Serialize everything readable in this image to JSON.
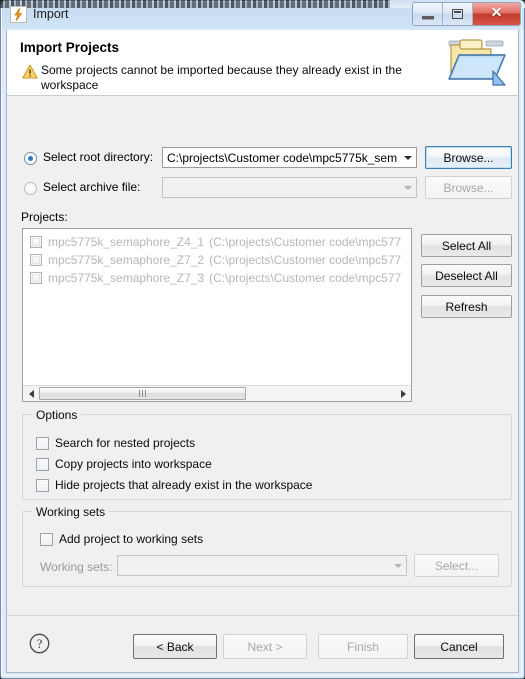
{
  "window": {
    "title": "Import",
    "app_icon": "import-wizard-icon",
    "controls": {
      "minimize": "minimize-button",
      "maximize": "restore-button",
      "close": "close-button"
    }
  },
  "header": {
    "title": "Import Projects",
    "message": "Some projects cannot be imported because they already exist in the workspace",
    "warning_icon": "warning-triangle-icon",
    "banner_icon": "open-folder-icon",
    "warning_color": "#f0b429"
  },
  "source": {
    "root_directory": {
      "label": "Select root directory:",
      "selected": true,
      "value": "C:\\projects\\Customer code\\mpc5775k_sem",
      "browse_label": "Browse...",
      "browse_enabled": true
    },
    "archive_file": {
      "label": "Select archive file:",
      "selected": false,
      "value": "",
      "browse_label": "Browse...",
      "browse_enabled": false
    }
  },
  "projects": {
    "label": "Projects:",
    "enabled": false,
    "items": [
      {
        "name": "mpc5775k_semaphore_Z4_1",
        "path": "(C:\\projects\\Customer code\\mpc577",
        "checked": false
      },
      {
        "name": "mpc5775k_semaphore_Z7_2",
        "path": "(C:\\projects\\Customer code\\mpc577",
        "checked": false
      },
      {
        "name": "mpc5775k_semaphore_Z7_3",
        "path": "(C:\\projects\\Customer code\\mpc577",
        "checked": false
      }
    ],
    "side_buttons": [
      {
        "label": "Select All",
        "enabled": true
      },
      {
        "label": "Deselect All",
        "enabled": true
      },
      {
        "label": "Refresh",
        "enabled": true
      }
    ],
    "scrollbar": {
      "orientation": "horizontal",
      "thumb_position": "left"
    }
  },
  "options": {
    "title": "Options",
    "items": [
      {
        "label": "Search for nested projects",
        "checked": false
      },
      {
        "label": "Copy projects into workspace",
        "checked": false
      },
      {
        "label": "Hide projects that already exist in the workspace",
        "checked": false
      }
    ]
  },
  "working_sets": {
    "title": "Working sets",
    "add_checkbox": {
      "label": "Add project to working sets",
      "checked": false
    },
    "field_label": "Working sets:",
    "field_value": "",
    "field_enabled": false,
    "select_label": "Select...",
    "select_enabled": false
  },
  "footer": {
    "help_icon": "help-question-icon",
    "buttons": [
      {
        "label": "< Back",
        "enabled": true,
        "name": "back-button"
      },
      {
        "label": "Next >",
        "enabled": false,
        "name": "next-button"
      },
      {
        "label": "Finish",
        "enabled": false,
        "name": "finish-button"
      },
      {
        "label": "Cancel",
        "enabled": true,
        "name": "cancel-button"
      }
    ]
  }
}
